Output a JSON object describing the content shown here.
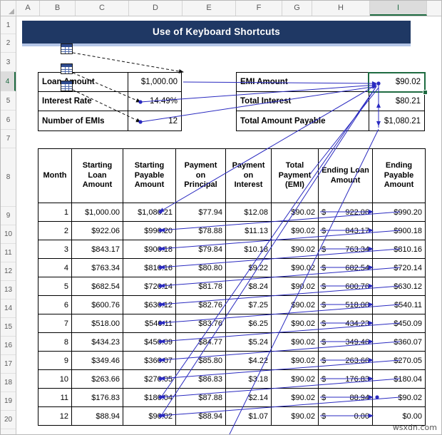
{
  "app": {
    "watermark": "wsxdn.com"
  },
  "grid": {
    "columns": [
      "A",
      "B",
      "C",
      "D",
      "E",
      "F",
      "G",
      "H",
      "I"
    ],
    "active_column": "I",
    "active_row": "4",
    "active_cell": "I4",
    "rows": [
      "1",
      "2",
      "3",
      "4",
      "5",
      "6",
      "7",
      "8",
      "9",
      "10",
      "11",
      "12",
      "13",
      "14",
      "15",
      "16",
      "17",
      "18",
      "19",
      "20"
    ]
  },
  "banner": {
    "title": "Use of Keyboard Shortcuts",
    "background": "#1f3864",
    "accent": "#b4c6e7"
  },
  "inputs": {
    "rows": [
      {
        "label": "Loan Amount",
        "value": "$1,000.00"
      },
      {
        "label": "Interest Rate",
        "value": "14.49%"
      },
      {
        "label": "Number of EMIs",
        "value": "12"
      }
    ]
  },
  "summary": {
    "rows": [
      {
        "label": "EMI Amount",
        "value": "$90.02"
      },
      {
        "label": "Total Interest",
        "value": "$80.21"
      },
      {
        "label": "Total Amount Payable",
        "value": "$1,080.21"
      }
    ]
  },
  "table": {
    "headers": [
      "Month",
      "Starting Loan Amount",
      "Starting Payable Amount",
      "Payment on Principal",
      "Payment on Interest",
      "Total Payment (EMI)",
      "Ending Loan Amount",
      "Ending Payable Amount"
    ],
    "rows": [
      [
        "1",
        "$1,000.00",
        "$1,080.21",
        "$77.94",
        "$12.08",
        "$90.02",
        "922.06",
        "$990.20"
      ],
      [
        "2",
        "$922.06",
        "$990.20",
        "$78.88",
        "$11.13",
        "$90.02",
        "843.17",
        "$900.18"
      ],
      [
        "3",
        "$843.17",
        "$900.18",
        "$79.84",
        "$10.18",
        "$90.02",
        "763.34",
        "$810.16"
      ],
      [
        "4",
        "$763.34",
        "$810.16",
        "$80.80",
        "$9.22",
        "$90.02",
        "682.54",
        "$720.14"
      ],
      [
        "5",
        "$682.54",
        "$720.14",
        "$81.78",
        "$8.24",
        "$90.02",
        "600.76",
        "$630.12"
      ],
      [
        "6",
        "$600.76",
        "$630.12",
        "$82.76",
        "$7.25",
        "$90.02",
        "518.00",
        "$540.11"
      ],
      [
        "7",
        "$518.00",
        "$540.11",
        "$83.76",
        "$6.25",
        "$90.02",
        "434.23",
        "$450.09"
      ],
      [
        "8",
        "$434.23",
        "$450.09",
        "$84.77",
        "$5.24",
        "$90.02",
        "349.46",
        "$360.07"
      ],
      [
        "9",
        "$349.46",
        "$360.07",
        "$85.80",
        "$4.22",
        "$90.02",
        "263.66",
        "$270.05"
      ],
      [
        "10",
        "$263.66",
        "$270.05",
        "$86.83",
        "$3.18",
        "$90.02",
        "176.83",
        "$180.04"
      ],
      [
        "11",
        "$176.83",
        "$180.04",
        "$87.88",
        "$2.14",
        "$90.02",
        "88.94",
        "$90.02"
      ],
      [
        "12",
        "$88.94",
        "$90.02",
        "$88.94",
        "$1.07",
        "$90.02",
        "0.00",
        "$0.00"
      ]
    ],
    "accounting_currency_symbol": "$"
  },
  "icons": {
    "worksheet_ref": "worksheet-icon",
    "tracer_arrow": "tracer-arrow"
  },
  "colors": {
    "tracer_precedent": "#2a2ac0",
    "tracer_external": "#1a1a1a",
    "active_border": "#1e6b41"
  }
}
